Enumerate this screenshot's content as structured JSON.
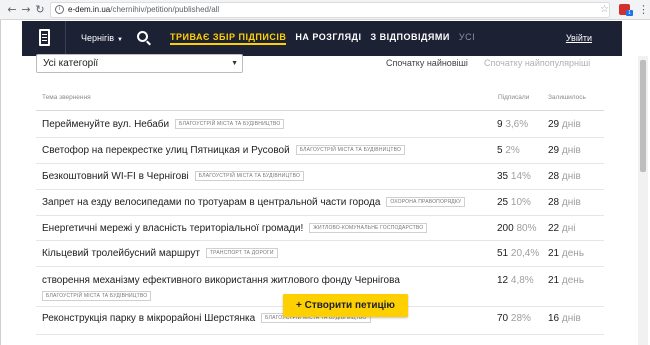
{
  "browser": {
    "url_host": "e-dem.in.ua",
    "url_path": "/chernihiv/petition/published/all",
    "back_icon": "back-arrow-icon",
    "forward_icon": "forward-arrow-icon",
    "reload_icon": "reload-icon",
    "lock_icon": "info-icon",
    "star_icon": "bookmark-star-icon",
    "menu_icon": "kebab-menu-icon",
    "extension_badge": "1"
  },
  "header": {
    "city": "Чернігів",
    "tabs": [
      {
        "label": "ТРИВАЄ ЗБІР ПІДПИСІВ",
        "state": "active"
      },
      {
        "label": "НА РОЗГЛЯДІ",
        "state": "normal"
      },
      {
        "label": "З ВІДПОВІДЯМИ",
        "state": "normal"
      },
      {
        "label": "УСІ",
        "state": "dim"
      }
    ],
    "login": "Увійти"
  },
  "filters": {
    "category": "Усі категорії",
    "sort_newest": "Спочатку найновіші",
    "sort_popular": "Спочатку найпопулярніші"
  },
  "table": {
    "col_topic": "Тема звернення",
    "col_signed": "Підписали",
    "col_left": "Залишилось",
    "rows": [
      {
        "title": "Перейменуйте вул. Небаби",
        "tag": "БЛАГОУСТРІЙ МІСТА ТА БУДІВНИЦТВО",
        "signed": "9",
        "pct": "3,6%",
        "days": "29",
        "unit": "днів"
      },
      {
        "title": "Светофор на перекрестке улиц Пятницкая и Русовой",
        "tag": "БЛАГОУСТРІЙ МІСТА ТА БУДІВНИЦТВО",
        "signed": "5",
        "pct": "2%",
        "days": "29",
        "unit": "днів"
      },
      {
        "title": "Безкоштовний WI-FI в Чернігові",
        "tag": "БЛАГОУСТРІЙ МІСТА ТА БУДІВНИЦТВО",
        "signed": "35",
        "pct": "14%",
        "days": "28",
        "unit": "днів"
      },
      {
        "title": "Запрет на езду велосипедами по тротуарам в центральной части города",
        "tag": "ОХОРОНА ПРАВОПОРЯДКУ",
        "signed": "25",
        "pct": "10%",
        "days": "28",
        "unit": "днів"
      },
      {
        "title": "Енергетичні мережі у власність територіальної громади!",
        "tag": "ЖИТЛОВО-КОМУНАЛЬНЕ ГОСПОДАРСТВО",
        "signed": "200",
        "pct": "80%",
        "days": "22",
        "unit": "дні"
      },
      {
        "title": "Кільцевий тролейбусний маршрут",
        "tag": "ТРАНСПОРТ ТА ДОРОГИ",
        "signed": "51",
        "pct": "20,4%",
        "days": "21",
        "unit": "день"
      },
      {
        "title": "створення механізму ефективного використання житлового фонду Чернігова",
        "tag": "БЛАГОУСТРІЙ МІСТА ТА БУДІВНИЦТВО",
        "signed": "12",
        "pct": "4,8%",
        "days": "21",
        "unit": "день"
      },
      {
        "title": "Реконструкція парку в мікрорайоні Шерстянка",
        "tag": "БЛАГОУСТРІЙ МІСТА ТА БУДІВНИЦТВО",
        "signed": "70",
        "pct": "28%",
        "days": "16",
        "unit": "днів"
      }
    ]
  },
  "create_button": "+ Створити петицію",
  "colors": {
    "header_bg": "#1c2133",
    "accent": "#ffd000"
  }
}
